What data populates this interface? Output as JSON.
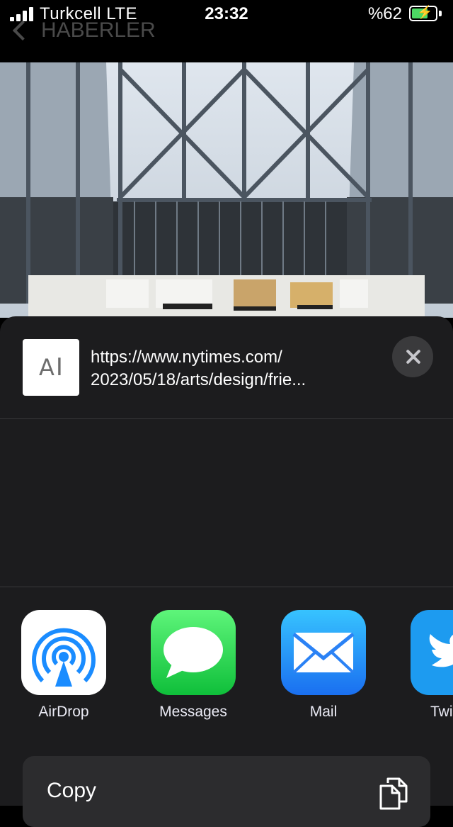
{
  "status_bar": {
    "carrier": "Turkcell  LTE",
    "time": "23:32",
    "battery": "%62",
    "battery_level": 0.62
  },
  "nav": {
    "back_label": "HABERLER"
  },
  "share_sheet": {
    "url_line1": "https://www.nytimes.com/",
    "url_line2": "2023/05/18/arts/design/frie...",
    "thumbnail_text": "A",
    "apps": [
      {
        "label": "AirDrop",
        "icon": "airdrop-icon"
      },
      {
        "label": "Messages",
        "icon": "messages-icon"
      },
      {
        "label": "Mail",
        "icon": "mail-icon"
      },
      {
        "label": "Twi",
        "icon": "twitter-icon"
      }
    ],
    "copy_label": "Copy"
  },
  "colors": {
    "sheet_bg": "#1c1c1e",
    "row_bg": "#2c2c2e",
    "battery_fill": "#4cd964"
  }
}
